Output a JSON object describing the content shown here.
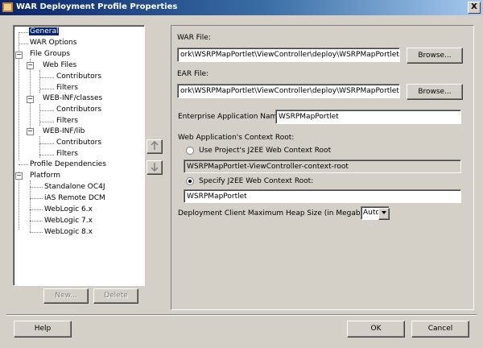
{
  "window": {
    "title": "WAR Deployment Profile Properties",
    "close_glyph": "X"
  },
  "tree": {
    "items": [
      {
        "label": "General",
        "selected": true
      },
      {
        "label": "WAR Options"
      },
      {
        "label": "File Groups"
      },
      {
        "label": "Web Files"
      },
      {
        "label": "Contributors"
      },
      {
        "label": "Filters"
      },
      {
        "label": "WEB-INF/classes"
      },
      {
        "label": "Contributors"
      },
      {
        "label": "Filters"
      },
      {
        "label": "WEB-INF/lib"
      },
      {
        "label": "Contributors"
      },
      {
        "label": "Filters"
      },
      {
        "label": "Profile Dependencies"
      },
      {
        "label": "Platform"
      },
      {
        "label": "Standalone OC4J"
      },
      {
        "label": "iAS Remote DCM"
      },
      {
        "label": "WebLogic 6.x"
      },
      {
        "label": "WebLogic 7.x"
      },
      {
        "label": "WebLogic 8.x"
      }
    ],
    "new_label": "New...",
    "delete_label": "Delete"
  },
  "general": {
    "war_file_label": "WAR File:",
    "war_file_value": "ork\\WSRPMapPortlet\\ViewController\\deploy\\WSRPMapPortlet.war",
    "ear_file_label": "EAR File:",
    "ear_file_value": "ork\\WSRPMapPortlet\\ViewController\\deploy\\WSRPMapPortlet.ear",
    "browse_label": "Browse...",
    "enterprise_app_label": "Enterprise Application Name:",
    "enterprise_app_value": "WSRPMapPortlet",
    "context_root_label": "Web Application's Context Root:",
    "use_project_label": "Use Project's J2EE Web Context Root",
    "project_context_value": "WSRPMapPortlet-ViewController-context-root",
    "specify_label": "Specify J2EE Web Context Root:",
    "specify_value": "WSRPMapPortlet",
    "heap_label": "Deployment Client Maximum Heap Size (in Megabytes):",
    "heap_value": "Auto"
  },
  "footer": {
    "help_label": "Help",
    "ok_label": "OK",
    "cancel_label": "Cancel"
  }
}
